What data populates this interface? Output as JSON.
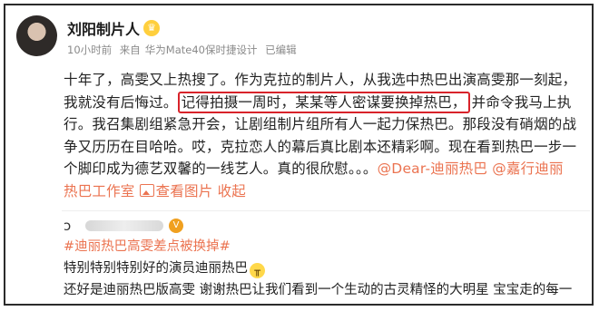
{
  "author": {
    "name": "刘阳制片人",
    "badge_icon": "vip-crown-icon",
    "time": "10小时前",
    "source_prefix": "来自",
    "device": "华为Mate40保时捷设计",
    "edited": "已编辑"
  },
  "post": {
    "line1": "十年了，高雯又上热搜了。作为克拉的制片人，从我选中热巴出演高雯那一刻起，",
    "line2_prefix": "我就没有后悔过。",
    "highlight": "记得拍摄一周时，某某等人密谋要换掉热巴，",
    "line2_suffix": "并命令我马上执",
    "line3": "行。我召集剧组紧急开会，让剧组制片组所有人一起力保热巴。那段没有硝烟的战",
    "line4": "争又历历在目哈哈。哎，克拉恋人的幕后真比剧本还精彩啊。现在看到热巴一步一",
    "line5_prefix": "个脚印成为德艺双馨的一线艺人。真的很欣慰。。。",
    "mention1": "@Dear-迪丽热巴",
    "mention2_part1": "@嘉行迪丽",
    "mention2_part2": "热巴工作室",
    "view_pics": "查看图片",
    "collapse": "收起"
  },
  "comment": {
    "logo_icon": "weibo-logo-icon",
    "level_badge": "V",
    "topic": "#迪丽热巴高雯差点被换掉#",
    "line1": "特别特别特别好的演员迪丽热巴",
    "emoji_icon": "crying-face-icon",
    "line2": "还好是迪丽热巴版高雯 谢谢热巴让我们看到一个生动的古灵精怪的大明星 宝宝走的每一"
  },
  "colors": {
    "highlight_border": "#d8232a",
    "link": "#eb7350",
    "meta_text": "#8a8a8a"
  }
}
